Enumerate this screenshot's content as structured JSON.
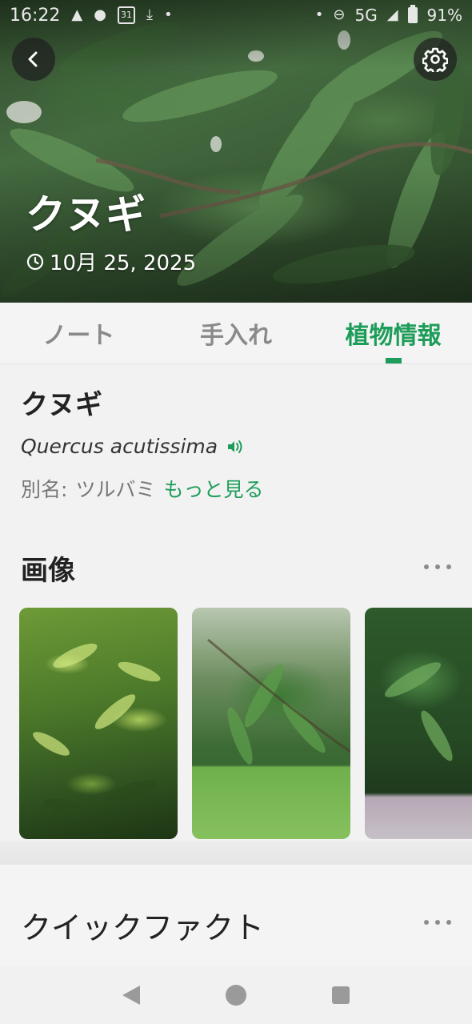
{
  "status_bar": {
    "time": "16:22",
    "network": "5G",
    "battery": "91%"
  },
  "header": {
    "title": "クヌギ",
    "date": "10月 25, 2025"
  },
  "tabs": [
    {
      "label": "ノート",
      "active": false
    },
    {
      "label": "手入れ",
      "active": false
    },
    {
      "label": "植物情報",
      "active": true
    }
  ],
  "plant": {
    "name": "クヌギ",
    "scientific_name": "Quercus acutissima",
    "alias_label": "別名:",
    "alias_value": "ツルバミ",
    "more_link": "もっと見る"
  },
  "images_section": {
    "title": "画像"
  },
  "quick_facts": {
    "title": "クイックファクト"
  },
  "colors": {
    "accent": "#1e9d5a",
    "tab_inactive": "#8a8a8a"
  }
}
